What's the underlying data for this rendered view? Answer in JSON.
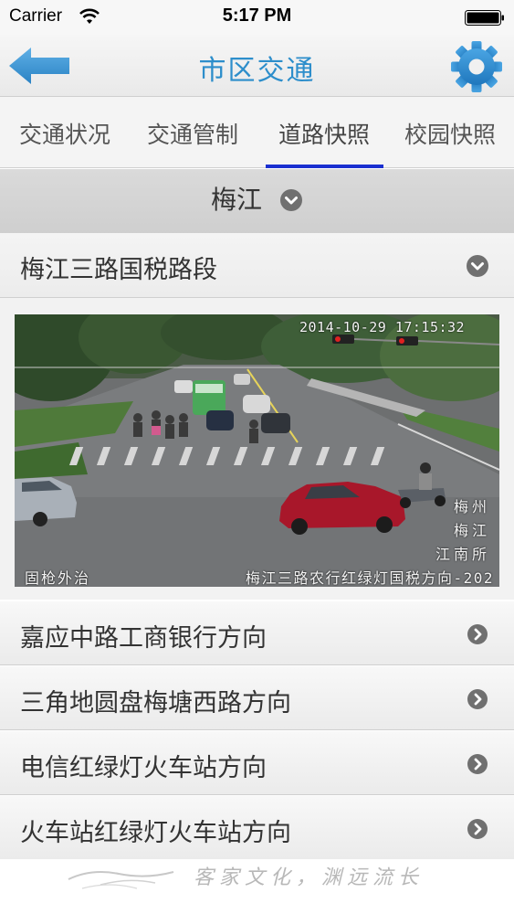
{
  "status_bar": {
    "carrier": "Carrier",
    "time": "5:17 PM"
  },
  "nav": {
    "title": "市区交通",
    "back_icon": "back-arrow-icon",
    "settings_icon": "gear-icon",
    "accent_color": "#2d8ecb"
  },
  "tabs": [
    {
      "label": "交通状况",
      "active": false
    },
    {
      "label": "交通管制",
      "active": false
    },
    {
      "label": "道路快照",
      "active": true
    },
    {
      "label": "校园快照",
      "active": false
    }
  ],
  "region": {
    "label": "梅江"
  },
  "section": {
    "label": "梅江三路国税路段"
  },
  "camera": {
    "timestamp": "2014-10-29 17:15:32",
    "location_line1": "梅州",
    "location_line2": "梅江",
    "location_line3": "江南所",
    "left_caption": "固枪外治",
    "right_caption": "梅江三路农行红绿灯国税方向-202"
  },
  "directions": [
    {
      "label": "嘉应中路工商银行方向"
    },
    {
      "label": "三角地圆盘梅塘西路方向"
    },
    {
      "label": "电信红绿灯火车站方向"
    },
    {
      "label": "火车站红绿灯火车站方向"
    }
  ],
  "footer": {
    "slogan": "客家文化，渊远流长"
  }
}
